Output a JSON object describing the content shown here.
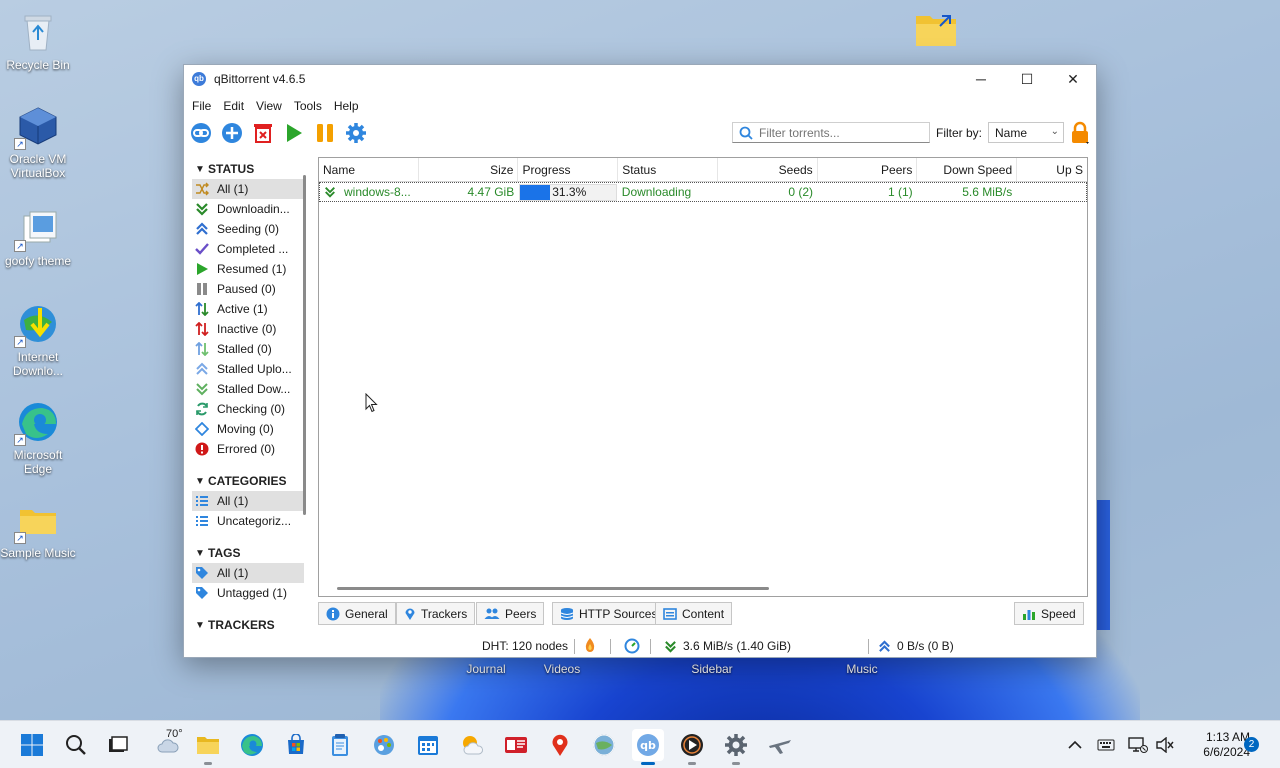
{
  "desktop": {
    "icons": [
      {
        "label": "Recycle Bin"
      },
      {
        "label": "Oracle VM VirtualBox"
      },
      {
        "label": "goofy theme"
      },
      {
        "label": "Internet Downlo..."
      },
      {
        "label": "Microsoft Edge"
      },
      {
        "label": "Sample Music"
      }
    ],
    "hidden_labels": [
      "Journal",
      "Videos",
      "Sidebar",
      "Music"
    ]
  },
  "window": {
    "title": "qBittorrent v4.6.5",
    "app_icon_text": "qb",
    "controls": {
      "minimize": "─",
      "maximize": "☐",
      "close": "✕"
    }
  },
  "menu": [
    "File",
    "Edit",
    "View",
    "Tools",
    "Help"
  ],
  "toolbar": {
    "filter_placeholder": "Filter torrents...",
    "filter_by_label": "Filter by:",
    "filter_by_value": "Name"
  },
  "sidebar": {
    "status_header": "STATUS",
    "status_items": [
      {
        "label": "All (1)",
        "icon": "all-icon"
      },
      {
        "label": "Downloadin...",
        "icon": "download-icon"
      },
      {
        "label": "Seeding (0)",
        "icon": "seeding-icon"
      },
      {
        "label": "Completed ...",
        "icon": "check-icon"
      },
      {
        "label": "Resumed (1)",
        "icon": "play-icon"
      },
      {
        "label": "Paused (0)",
        "icon": "pause-icon"
      },
      {
        "label": "Active (1)",
        "icon": "active-icon"
      },
      {
        "label": "Inactive (0)",
        "icon": "inactive-icon"
      },
      {
        "label": "Stalled (0)",
        "icon": "stalled-icon"
      },
      {
        "label": "Stalled Uplo...",
        "icon": "stalled-upload-icon"
      },
      {
        "label": "Stalled Dow...",
        "icon": "stalled-download-icon"
      },
      {
        "label": "Checking (0)",
        "icon": "checking-icon"
      },
      {
        "label": "Moving (0)",
        "icon": "moving-icon"
      },
      {
        "label": "Errored (0)",
        "icon": "error-icon"
      }
    ],
    "categories_header": "CATEGORIES",
    "category_items": [
      {
        "label": "All (1)"
      },
      {
        "label": "Uncategoriz..."
      }
    ],
    "tags_header": "TAGS",
    "tag_items": [
      {
        "label": "All (1)"
      },
      {
        "label": "Untagged (1)"
      }
    ],
    "trackers_header": "TRACKERS"
  },
  "table": {
    "columns": [
      "Name",
      "Size",
      "Progress",
      "Status",
      "Seeds",
      "Peers",
      "Down Speed",
      "Up S"
    ],
    "rows": [
      {
        "name": "windows-8...",
        "size": "4.47 GiB",
        "progress_text": "31.3%",
        "progress": 0.313,
        "status": "Downloading",
        "seeds": "0 (2)",
        "peers": "1 (1)",
        "down_speed": "5.6 MiB/s",
        "up_speed": ""
      }
    ]
  },
  "tabs": [
    "General",
    "Trackers",
    "Peers",
    "HTTP Sources",
    "Content"
  ],
  "speed_button": "Speed",
  "statusbar": {
    "dht": "DHT: 120 nodes",
    "download": "3.6 MiB/s (1.40 GiB)",
    "upload": "0 B/s (0 B)"
  },
  "taskbar": {
    "weather_temp": "70°",
    "time": "1:13 AM",
    "date": "6/6/2024",
    "notifications": "2"
  },
  "colors": {
    "accent": "#1a73e8",
    "downloading_green": "#2a8a2a",
    "pause_orange": "#f4a000",
    "remove_red": "#e02020"
  }
}
